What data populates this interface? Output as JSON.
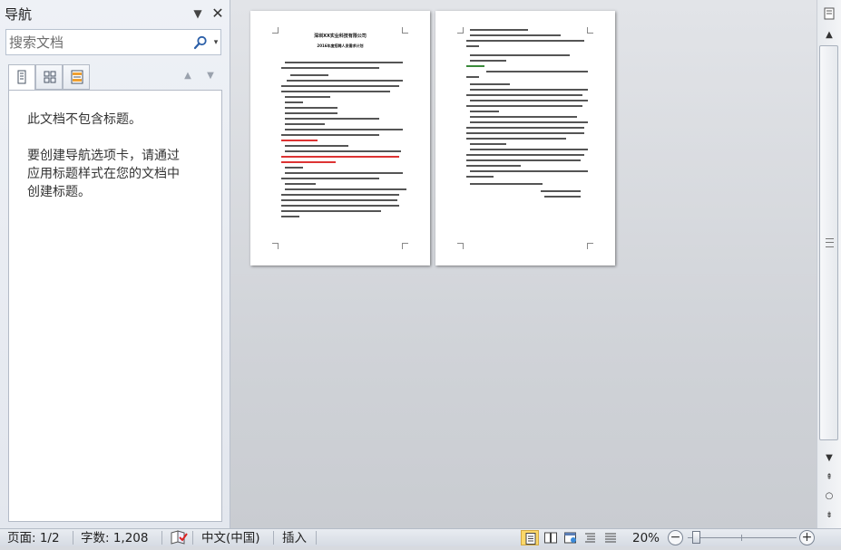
{
  "navigation": {
    "title": "导航",
    "search_placeholder": "搜索文档",
    "empty_message": "此文档不包含标题。",
    "hint_lines": [
      "要创建导航选项卡，请通过",
      "应用标题样式在您的文档中",
      "创建标题。"
    ]
  },
  "document": {
    "page1": {
      "title": "深圳XX实业科技有限公司",
      "subtitle": "2016年度招聘人员需求计划"
    }
  },
  "status_bar": {
    "page": "页面: 1/2",
    "words": "字数: 1,208",
    "language": "中文(中国)",
    "mode": "插入",
    "zoom": "20%",
    "zoom_percent": 20
  },
  "icons": {
    "nav_menu": "dropdown-triangle-icon",
    "nav_close": "close-icon",
    "search": "magnifier-icon",
    "spellcheck": "proofing-book-icon"
  },
  "colors": {
    "accent_view": "#fbd86a",
    "highlight_text": "#d33333"
  }
}
